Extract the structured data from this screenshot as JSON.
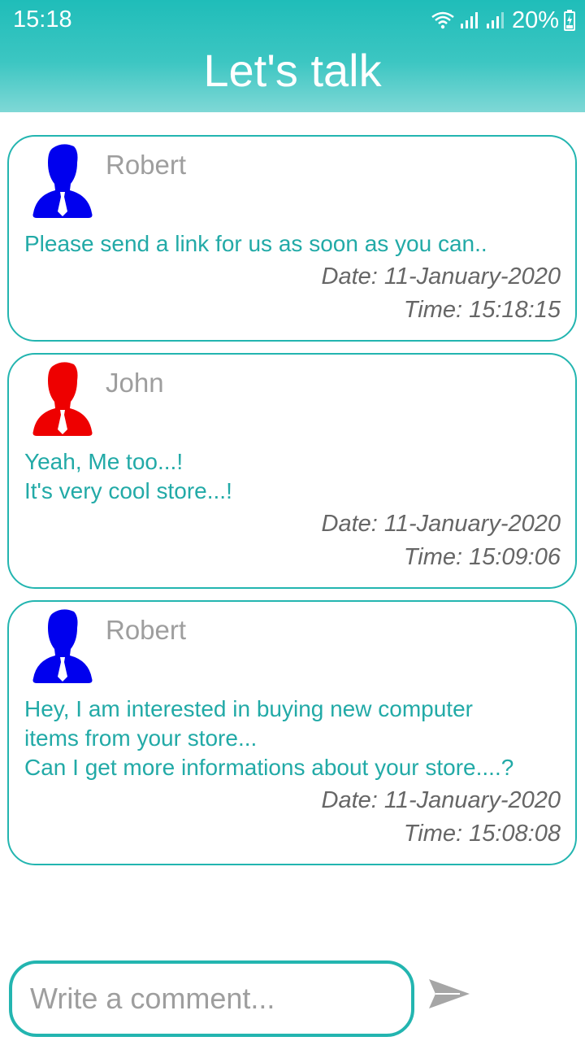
{
  "status_bar": {
    "time": "15:18",
    "battery": "20%"
  },
  "header": {
    "title": "Let's talk"
  },
  "messages": [
    {
      "sender": "Robert",
      "avatar_color": "#0000ee",
      "text": "Please send a link for us as soon as you can..",
      "date": "Date: 11-January-2020",
      "time": "Time: 15:18:15"
    },
    {
      "sender": "John",
      "avatar_color": "#ee0000",
      "text": "Yeah, Me too...!\nIt's very cool store...!",
      "date": "Date: 11-January-2020",
      "time": "Time: 15:09:06"
    },
    {
      "sender": "Robert",
      "avatar_color": "#0000ee",
      "text": "Hey, I am interested in buying new computer\nitems from your store...\nCan I get more informations about your store....?",
      "date": "Date: 11-January-2020",
      "time": "Time: 15:08:08"
    }
  ],
  "composer": {
    "placeholder": "Write a comment...",
    "send_icon": "send-arrow"
  },
  "colors": {
    "accent": "#23b5b0",
    "message_text": "#22aaa7",
    "sender_text": "#9e9e9e"
  }
}
